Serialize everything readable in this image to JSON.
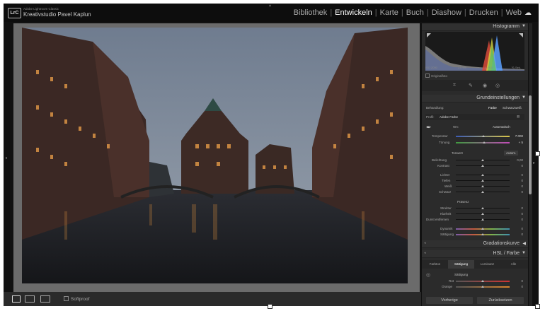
{
  "app": {
    "name": "Adobe Lightroom Classic",
    "catalog": "Kreativstudio Pavel Kaplun",
    "logo": "LrC"
  },
  "modules": [
    {
      "label": "Bibliothek",
      "active": false
    },
    {
      "label": "Entwickeln",
      "active": true
    },
    {
      "label": "Karte",
      "active": false
    },
    {
      "label": "Buch",
      "active": false
    },
    {
      "label": "Diashow",
      "active": false
    },
    {
      "label": "Drucken",
      "active": false
    },
    {
      "label": "Web",
      "active": false
    }
  ],
  "filmstrip": {
    "softproof_label": "Softproof"
  },
  "histogram": {
    "title": "Histogramm",
    "info_iso": "ISO 2000",
    "info_focal": "23 mm",
    "info_aperture": "ƒ / 4,0",
    "info_shutter": "⅙ Sek.",
    "original_photo_label": "Originalfoto"
  },
  "basic": {
    "title": "Grundeinstellungen",
    "treatment_label": "Behandlung:",
    "treatment_color": "Farbe",
    "treatment_bw": "Schwarzweiß",
    "profile_label": "Profil:",
    "profile_value": "Adobe Farbe",
    "wb_label": "WA:",
    "wb_value": "Automatisch",
    "temperature_label": "Temperatur",
    "temperature_value": "7.000",
    "tint_label": "Tönung",
    "tint_value": "+ 5",
    "tone_header": "Tonwert",
    "tone_auto": "Autom.",
    "exposure_label": "Belichtung",
    "exposure_value": "0,00",
    "contrast_label": "Kontrast",
    "contrast_value": "0",
    "highlights_label": "Lichter",
    "highlights_value": "0",
    "shadows_label": "Tiefen",
    "shadows_value": "0",
    "whites_label": "Weiß",
    "whites_value": "0",
    "blacks_label": "Schwarz",
    "blacks_value": "0",
    "presence_header": "Präsenz",
    "texture_label": "Struktur",
    "texture_value": "0",
    "clarity_label": "Klarheit",
    "clarity_value": "0",
    "dehaze_label": "Dunst entfernen",
    "dehaze_value": "0",
    "vibrance_label": "Dynamik",
    "vibrance_value": "0",
    "saturation_label": "Sättigung",
    "saturation_value": "0"
  },
  "tone_curve": {
    "title": "Gradationskurve"
  },
  "hsl": {
    "title": "HSL / Farbe",
    "tabs": [
      "Farbton",
      "Sättigung",
      "Luminanz",
      "Alle"
    ],
    "active_tab": 1,
    "section_label": "Sättigung",
    "red_label": "Rot",
    "red_value": "0",
    "orange_label": "Orange",
    "orange_value": "0"
  },
  "buttons": {
    "previous": "Vorherige",
    "reset": "Zurücksetzen"
  },
  "colors": {
    "accent": "#ffffff",
    "panel_bg": "#2b2b2b",
    "canvas_bg": "#6b6b6b"
  }
}
